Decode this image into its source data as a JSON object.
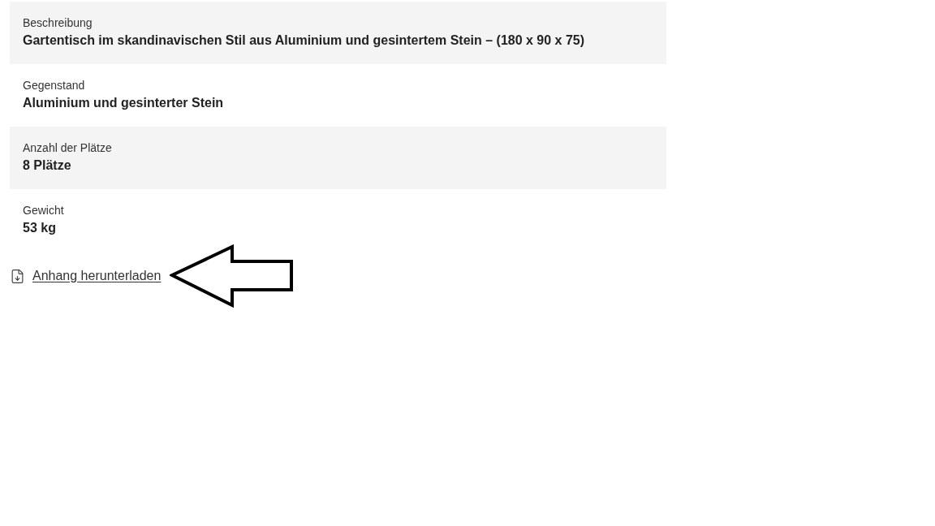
{
  "details": [
    {
      "label": "Beschreibung",
      "value": "Gartentisch im skandinavischen Stil aus Aluminium und gesintertem Stein – (180 x 90 x 75)"
    },
    {
      "label": "Gegenstand",
      "value": "Aluminium und gesinterter Stein"
    },
    {
      "label": "Anzahl der Plätze",
      "value": "8 Plätze"
    },
    {
      "label": "Gewicht",
      "value": "53 kg"
    }
  ],
  "attachment_link": {
    "label": "Anhang herunterladen"
  }
}
